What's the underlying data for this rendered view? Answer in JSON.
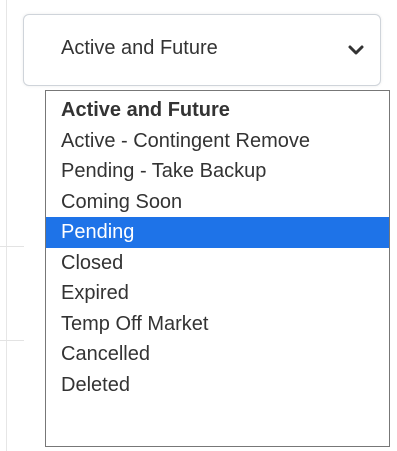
{
  "select": {
    "value": "Active and Future"
  },
  "dropdown": {
    "options": [
      {
        "label": "Active and Future"
      },
      {
        "label": "Active - Contingent Remove"
      },
      {
        "label": "Pending - Take Backup"
      },
      {
        "label": "Coming Soon"
      },
      {
        "label": "Pending"
      },
      {
        "label": "Closed"
      },
      {
        "label": "Expired"
      },
      {
        "label": "Temp Off Market"
      },
      {
        "label": "Cancelled"
      },
      {
        "label": "Deleted"
      }
    ],
    "selected_index": 0,
    "highlighted_index": 4
  },
  "colors": {
    "highlight": "#1e73e8",
    "text": "#333333",
    "border": "#777777"
  },
  "icons": {
    "chevron": "chevron-down-icon"
  }
}
